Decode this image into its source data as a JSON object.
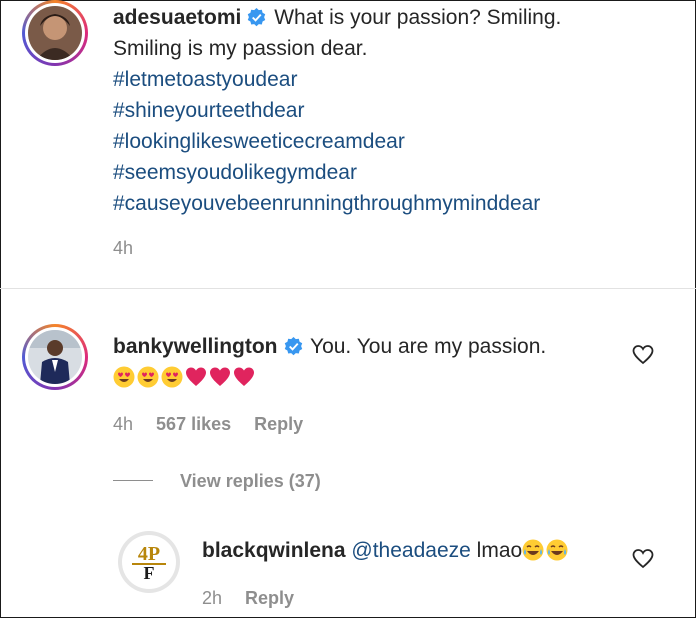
{
  "comments": [
    {
      "username": "adesuaetomi",
      "text": "What is your passion? Smiling.",
      "text_line2": "Smiling is my passion dear.",
      "hashtags": [
        "#letmetoastyoudear",
        "#shineyourteethdear",
        "#lookinglikesweeticecreamdear",
        "#seemsyoudolikegymdear",
        "#causeyouvebeenrunningthroughmyminddear"
      ],
      "time": "4h"
    },
    {
      "username": "bankywellington",
      "text": "You. You are my passion.",
      "emojis": [
        "smiling-heart-eyes",
        "smiling-heart-eyes",
        "smiling-heart-eyes",
        "red-heart",
        "red-heart",
        "red-heart"
      ],
      "time": "4h",
      "likes": "567 likes",
      "reply_label": "Reply",
      "view_replies": "View replies (37)"
    },
    {
      "username": "blackqwinlena",
      "mention": "@theadaeze",
      "text": "lmao",
      "emojis": [
        "tears-of-joy",
        "tears-of-joy"
      ],
      "time": "2h",
      "reply_label": "Reply"
    }
  ],
  "colors": {
    "hashtag": "#1b4d7f",
    "verified": "#3897f0",
    "meta": "#8e8e8e",
    "heart_emoji": "#e0245e"
  }
}
